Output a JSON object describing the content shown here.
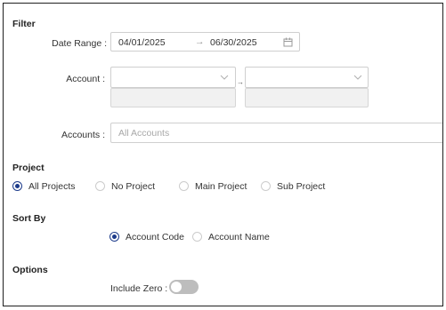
{
  "filter": {
    "title": "Filter",
    "date_range": {
      "label": "Date Range :",
      "start": "04/01/2025",
      "separator": "→",
      "end": "06/30/2025"
    },
    "account": {
      "label": "Account :",
      "separator": "→"
    },
    "accounts": {
      "label": "Accounts :",
      "placeholder": "All Accounts"
    }
  },
  "project": {
    "title": "Project",
    "options": [
      {
        "label": "All Projects",
        "selected": true
      },
      {
        "label": "No Project",
        "selected": false
      },
      {
        "label": "Main Project",
        "selected": false
      },
      {
        "label": "Sub Project",
        "selected": false
      }
    ]
  },
  "sort_by": {
    "title": "Sort By",
    "options": [
      {
        "label": "Account Code",
        "selected": true
      },
      {
        "label": "Account Name",
        "selected": false
      }
    ]
  },
  "options": {
    "title": "Options",
    "include_zero": {
      "label": "Include Zero :",
      "value": false
    }
  },
  "colors": {
    "accent": "#1d3b8b",
    "toggle_off": "#bdbdbd",
    "border": "#cfcfcf"
  }
}
